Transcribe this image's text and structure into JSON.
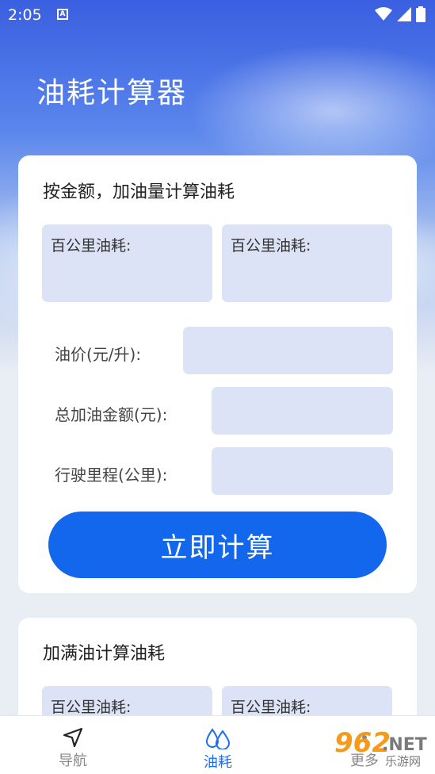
{
  "status_bar": {
    "time": "2:05",
    "indicator": "A"
  },
  "app_title": "油耗计算器",
  "card1": {
    "title": "按金额，加油量计算油耗",
    "result_left_label": "百公里油耗:",
    "result_right_label": "百公里油耗:",
    "oil_price_label": "油价(元/升):",
    "total_amount_label": "总加油金额(元):",
    "distance_label": "行驶里程(公里):",
    "calculate_button": "立即计算"
  },
  "card2": {
    "title": "加满油计算油耗",
    "result_left_label": "百公里油耗:",
    "result_right_label": "百公里油耗:"
  },
  "bottom_nav": {
    "items": [
      {
        "label": "导航",
        "icon": "navigation-arrow-icon",
        "active": false
      },
      {
        "label": "油耗",
        "icon": "water-drops-icon",
        "active": true
      },
      {
        "label": "更多",
        "icon": "more-icon",
        "active": false
      }
    ]
  },
  "watermark": {
    "main": "962",
    "net": ".NET",
    "sub": "乐游网"
  },
  "colors": {
    "primary": "#1267ec",
    "input_bg": "#dde3f6",
    "active_tab": "#1d6ef0",
    "inactive_tab": "#888888"
  }
}
